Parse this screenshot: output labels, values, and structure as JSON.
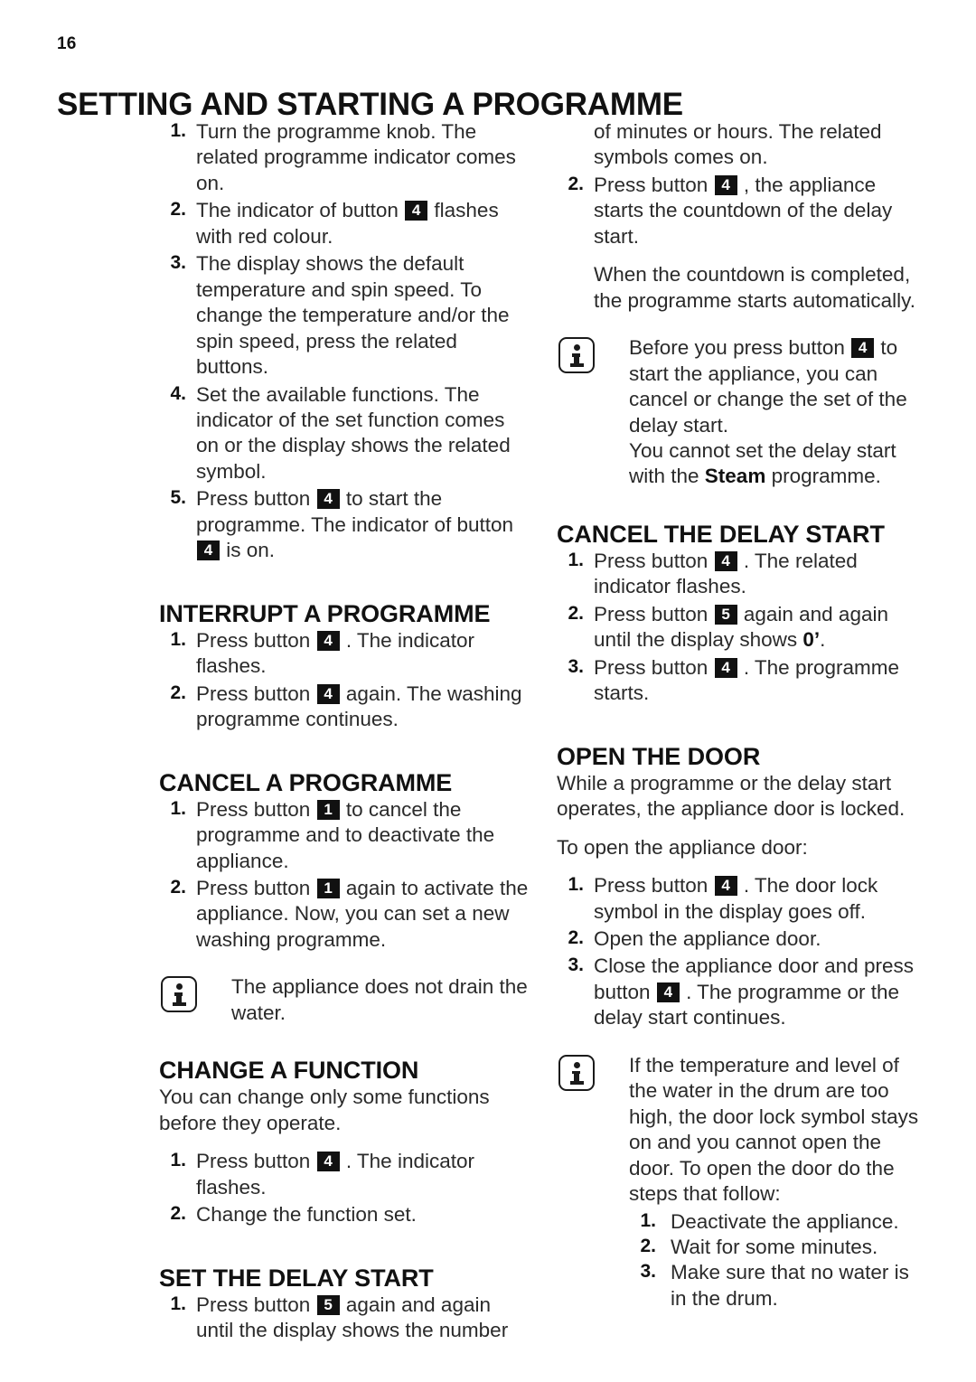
{
  "document": {
    "page_number": "16",
    "title": "SETTING AND STARTING A PROGRAMME"
  },
  "icons": {
    "info": "info-icon"
  },
  "left_column": {
    "intro_steps": [
      {
        "num": "1.",
        "parts": [
          {
            "t": "text",
            "v": "Turn the programme knob. The related programme indicator comes on."
          }
        ]
      },
      {
        "num": "2.",
        "parts": [
          {
            "t": "text",
            "v": "The indicator of button "
          },
          {
            "t": "key",
            "v": "4"
          },
          {
            "t": "text",
            "v": " flashes with red colour."
          }
        ]
      },
      {
        "num": "3.",
        "parts": [
          {
            "t": "text",
            "v": "The display shows the default temperature and spin speed. To change the temperature and/or the spin speed, press the related buttons."
          }
        ]
      },
      {
        "num": "4.",
        "parts": [
          {
            "t": "text",
            "v": "Set the available functions. The indicator of the set function comes on or the display shows the related symbol."
          }
        ]
      },
      {
        "num": "5.",
        "parts": [
          {
            "t": "text",
            "v": "Press button "
          },
          {
            "t": "key",
            "v": "4"
          },
          {
            "t": "text",
            "v": " to start the programme. The indicator of button "
          },
          {
            "t": "key",
            "v": "4"
          },
          {
            "t": "text",
            "v": " is on."
          }
        ]
      }
    ],
    "interrupt": {
      "heading": "INTERRUPT A PROGRAMME",
      "steps": [
        {
          "num": "1.",
          "parts": [
            {
              "t": "text",
              "v": "Press button "
            },
            {
              "t": "key",
              "v": "4"
            },
            {
              "t": "text",
              "v": " . The indicator flashes."
            }
          ]
        },
        {
          "num": "2.",
          "parts": [
            {
              "t": "text",
              "v": "Press button "
            },
            {
              "t": "key",
              "v": "4"
            },
            {
              "t": "text",
              "v": " again. The washing programme continues."
            }
          ]
        }
      ]
    },
    "cancel_programme": {
      "heading": "CANCEL A PROGRAMME",
      "steps": [
        {
          "num": "1.",
          "parts": [
            {
              "t": "text",
              "v": "Press button "
            },
            {
              "t": "key",
              "v": "1"
            },
            {
              "t": "text",
              "v": " to cancel the programme and to deactivate the appliance."
            }
          ]
        },
        {
          "num": "2.",
          "parts": [
            {
              "t": "text",
              "v": "Press button "
            },
            {
              "t": "key",
              "v": "1"
            },
            {
              "t": "text",
              "v": " again to activate the appliance. Now, you can set a new washing programme."
            }
          ]
        }
      ],
      "note": [
        {
          "t": "text",
          "v": "The appliance does not drain the water."
        }
      ]
    },
    "change_function": {
      "heading": "CHANGE A FUNCTION",
      "intro": "You can change only some functions before they operate.",
      "steps": [
        {
          "num": "1.",
          "parts": [
            {
              "t": "text",
              "v": "Press button "
            },
            {
              "t": "key",
              "v": "4"
            },
            {
              "t": "text",
              "v": " . The indicator flashes."
            }
          ]
        },
        {
          "num": "2.",
          "parts": [
            {
              "t": "text",
              "v": "Change the function set."
            }
          ]
        }
      ]
    },
    "set_delay_start": {
      "heading": "SET THE DELAY START",
      "steps": [
        {
          "num": "1.",
          "parts": [
            {
              "t": "text",
              "v": "Press button "
            },
            {
              "t": "key",
              "v": "5"
            },
            {
              "t": "text",
              "v": " again and again until the display shows the number"
            }
          ]
        }
      ]
    }
  },
  "right_column": {
    "delay_start_continued": {
      "steps": [
        {
          "num": "",
          "parts": [
            {
              "t": "text",
              "v": "of minutes or hours. The related symbols comes on."
            }
          ]
        },
        {
          "num": "2.",
          "parts": [
            {
              "t": "text",
              "v": "Press button "
            },
            {
              "t": "key",
              "v": "4"
            },
            {
              "t": "text",
              "v": " , the appliance starts the countdown of the delay start."
            }
          ]
        }
      ],
      "continuation": "When the countdown is completed, the programme starts automatically.",
      "note": [
        {
          "t": "text",
          "v": "Before you press button "
        },
        {
          "t": "key",
          "v": "4"
        },
        {
          "t": "text",
          "v": " to start the appliance, you can cancel or change the set of the delay start."
        },
        {
          "t": "break",
          "v": ""
        },
        {
          "t": "text",
          "v": "You cannot set the delay start with the "
        },
        {
          "t": "bold",
          "v": "Steam"
        },
        {
          "t": "text",
          "v": " programme."
        }
      ]
    },
    "cancel_delay_start": {
      "heading": "CANCEL THE DELAY START",
      "steps": [
        {
          "num": "1.",
          "parts": [
            {
              "t": "text",
              "v": "Press button "
            },
            {
              "t": "key",
              "v": "4"
            },
            {
              "t": "text",
              "v": " . The related indicator flashes."
            }
          ]
        },
        {
          "num": "2.",
          "parts": [
            {
              "t": "text",
              "v": "Press button "
            },
            {
              "t": "key",
              "v": "5"
            },
            {
              "t": "text",
              "v": " again and again until the display shows "
            },
            {
              "t": "bold",
              "v": "0’"
            },
            {
              "t": "text",
              "v": "."
            }
          ]
        },
        {
          "num": "3.",
          "parts": [
            {
              "t": "text",
              "v": "Press button "
            },
            {
              "t": "key",
              "v": "4"
            },
            {
              "t": "text",
              "v": " . The programme starts."
            }
          ]
        }
      ]
    },
    "open_the_door": {
      "heading": "OPEN THE DOOR",
      "intro_1": "While a programme or the delay start operates, the appliance door is locked.",
      "intro_2": "To open the appliance door:",
      "steps": [
        {
          "num": "1.",
          "parts": [
            {
              "t": "text",
              "v": "Press button "
            },
            {
              "t": "key",
              "v": "4"
            },
            {
              "t": "text",
              "v": " . The door lock symbol in the display goes off."
            }
          ]
        },
        {
          "num": "2.",
          "parts": [
            {
              "t": "text",
              "v": "Open the appliance door."
            }
          ]
        },
        {
          "num": "3.",
          "parts": [
            {
              "t": "text",
              "v": "Close the appliance door and press button "
            },
            {
              "t": "key",
              "v": "4"
            },
            {
              "t": "text",
              "v": " . The programme or the delay start continues."
            }
          ]
        }
      ],
      "note": [
        {
          "t": "text",
          "v": "If the temperature and level of the water in the drum are too high, the door lock symbol stays on and you cannot open the door. To open the door do the steps that follow:"
        }
      ],
      "note_steps": [
        {
          "num": "1.",
          "parts": [
            {
              "t": "text",
              "v": "Deactivate the appliance."
            }
          ]
        },
        {
          "num": "2.",
          "parts": [
            {
              "t": "text",
              "v": "Wait for some minutes."
            }
          ]
        },
        {
          "num": "3.",
          "parts": [
            {
              "t": "text",
              "v": "Make sure that no water is in the drum."
            }
          ]
        }
      ]
    }
  }
}
